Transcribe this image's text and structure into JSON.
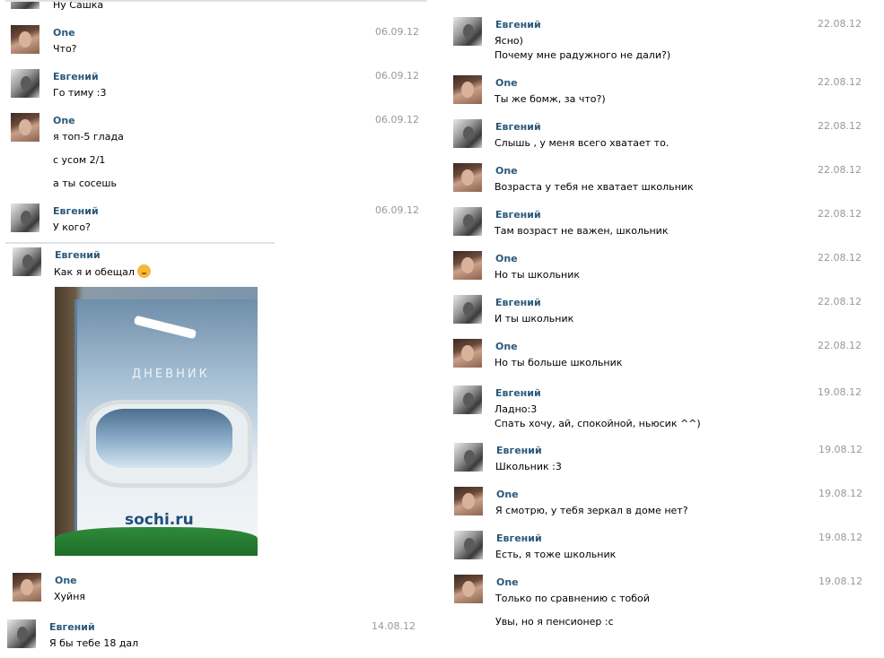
{
  "left_column": {
    "partial_top_line": "Ну Сашка",
    "messages": [
      {
        "name": "One",
        "date": "06.09.12",
        "lines": [
          "Что?"
        ]
      },
      {
        "name": "Евгений",
        "date": "06.09.12",
        "lines": [
          "Го тиму :3"
        ]
      },
      {
        "name": "One",
        "date": "06.09.12",
        "lines": [
          "я топ-5 глада",
          "с усом 2/1",
          "а ты сосешь"
        ]
      },
      {
        "name": "Евгений",
        "date": "06.09.12",
        "lines": [
          "У кого?"
        ]
      },
      {
        "name": "Евгений",
        "date": "",
        "lines": [
          "Как я и обещал"
        ]
      },
      {
        "name": "One",
        "date": "",
        "lines": [
          "Хуйня"
        ]
      },
      {
        "name": "Евгений",
        "date": "14.08.12",
        "lines": [
          "Я бы тебе 18 дал"
        ]
      }
    ],
    "photo": {
      "cover_title": "ДНЕВНИК",
      "brand": "sochi.ru"
    }
  },
  "right_column": {
    "messages": [
      {
        "name": "Евгений",
        "date": "22.08.12",
        "lines": [
          "Ясно)",
          "Почему мне радужного не дали?)"
        ]
      },
      {
        "name": "One",
        "date": "22.08.12",
        "lines": [
          "Ты же бомж, за что?)"
        ]
      },
      {
        "name": "Евгений",
        "date": "22.08.12",
        "lines": [
          "Слышь , у меня всего хватает то."
        ]
      },
      {
        "name": "One",
        "date": "22.08.12",
        "lines": [
          "Возраста у тебя не хватает школьник"
        ]
      },
      {
        "name": "Евгений",
        "date": "22.08.12",
        "lines": [
          "Там возраст не важен, школьник"
        ]
      },
      {
        "name": "One",
        "date": "22.08.12",
        "lines": [
          "Но ты школьник"
        ]
      },
      {
        "name": "Евгений",
        "date": "22.08.12",
        "lines": [
          "И ты школьник"
        ]
      },
      {
        "name": "One",
        "date": "22.08.12",
        "lines": [
          "Но ты больше школьник"
        ]
      },
      {
        "name": "Евгений",
        "date": "19.08.12",
        "lines": [
          "Ладно:3",
          "Спать хочу, ай, спокойной, ньюсик ^^)"
        ]
      },
      {
        "name": "Евгений",
        "date": "19.08.12",
        "lines": [
          "Школьник :3"
        ]
      },
      {
        "name": "One",
        "date": "19.08.12",
        "lines": [
          "Я смотрю, у тебя зеркал в доме нет?"
        ]
      },
      {
        "name": "Евгений",
        "date": "19.08.12",
        "lines": [
          "Есть, я тоже школьник"
        ]
      },
      {
        "name": "One",
        "date": "19.08.12",
        "lines": [
          "Только по сравнению с тобой",
          "Увы, но я пенсионер :с"
        ]
      }
    ]
  },
  "colors": {
    "name": "#2b587a",
    "date": "#999999",
    "separator": "#dfe3e8"
  },
  "icons": {
    "emoji": "kissing-face-icon",
    "photo": "photo-attachment"
  }
}
